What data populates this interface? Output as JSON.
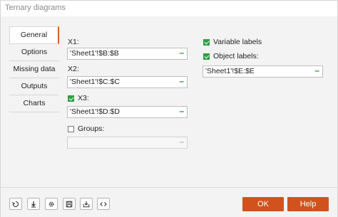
{
  "window": {
    "title": "Ternary diagrams"
  },
  "tabs": [
    {
      "label": "General"
    },
    {
      "label": "Options"
    },
    {
      "label": "Missing data"
    },
    {
      "label": "Outputs"
    },
    {
      "label": "Charts"
    }
  ],
  "general": {
    "x1": {
      "label": "X1:",
      "value": "'Sheet1'!$B:$B"
    },
    "x2": {
      "label": "X2:",
      "value": "'Sheet1'!$C:$C"
    },
    "x3": {
      "label": "X3:",
      "value": "'Sheet1'!$D:$D",
      "checked": true
    },
    "groups": {
      "label": "Groups:",
      "value": "",
      "checked": false
    },
    "variable_labels": {
      "label": "Variable labels",
      "checked": true
    },
    "object_labels": {
      "label": "Object labels:",
      "checked": true,
      "value": "'Sheet1'!$E:$E"
    },
    "clear_symbol": "–"
  },
  "footer": {
    "ok_label": "OK",
    "help_label": "Help",
    "icons": [
      "reset-icon",
      "download-icon",
      "settings-icon",
      "save-icon",
      "load-icon",
      "code-icon"
    ]
  },
  "colors": {
    "accent": "#d2521d",
    "check": "#2f9e44"
  }
}
